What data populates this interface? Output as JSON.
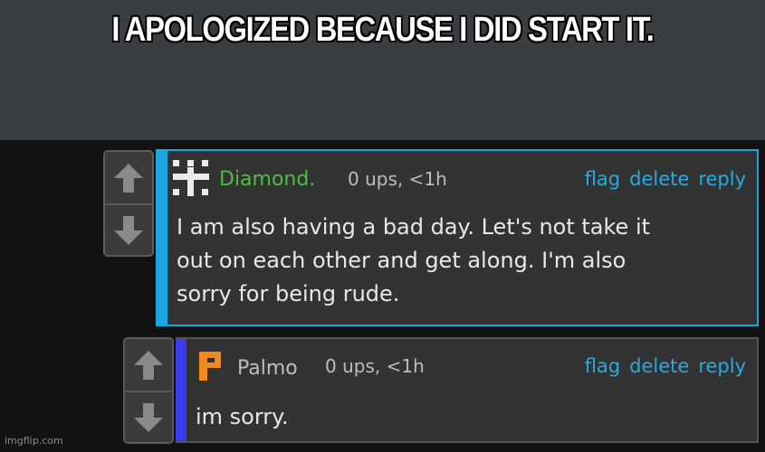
{
  "caption": "I APOLOGIZED BECAUSE I DID START IT.",
  "comments": [
    {
      "username": "Diamond.",
      "username_color": "#4bbd42",
      "avatar_icon": "diamond-pixel-icon",
      "ups": "0 ups, <1h",
      "actions": [
        "flag",
        "delete",
        "reply"
      ],
      "body_lines": [
        "I am also having a bad day. Let's not take it",
        "out on each other and get along. I'm also",
        "sorry for being rude."
      ],
      "accent_color": "#1aa7e0"
    },
    {
      "username": "Palmo",
      "username_color": "#bdbdbd",
      "avatar_icon": "palmo-p-icon",
      "ups": "0 ups, <1h",
      "actions": [
        "flag",
        "delete",
        "reply"
      ],
      "body_lines": [
        "im sorry."
      ],
      "accent_color": "#3b3bf0"
    }
  ],
  "watermark": "imgflip.com"
}
